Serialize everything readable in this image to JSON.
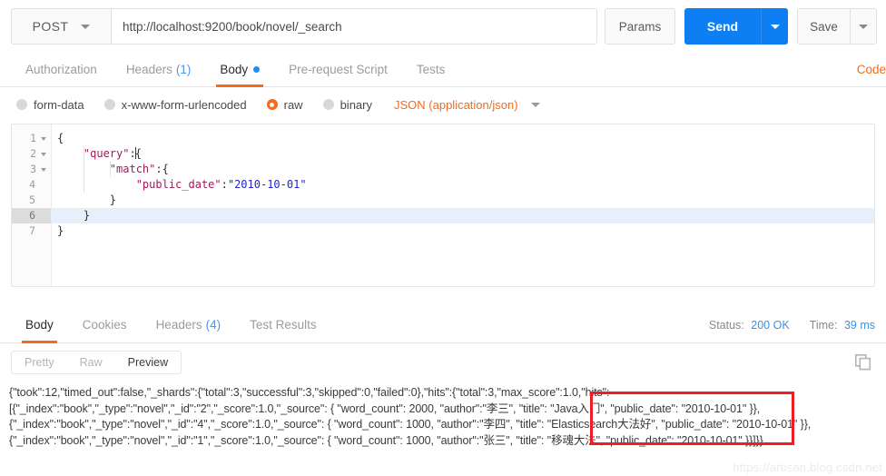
{
  "request": {
    "method": "POST",
    "url": "http://localhost:9200/book/novel/_search",
    "params_label": "Params",
    "send_label": "Send",
    "save_label": "Save",
    "tabs": [
      {
        "label": "Authorization",
        "count": "",
        "active": false
      },
      {
        "label": "Headers",
        "count": "(1)",
        "active": false
      },
      {
        "label": "Body",
        "count": "",
        "active": true
      },
      {
        "label": "Pre-request Script",
        "count": "",
        "active": false
      },
      {
        "label": "Tests",
        "count": "",
        "active": false
      }
    ],
    "code_link": "Code",
    "body_types": [
      {
        "label": "form-data",
        "selected": false
      },
      {
        "label": "x-www-form-urlencoded",
        "selected": false
      },
      {
        "label": "raw",
        "selected": true
      },
      {
        "label": "binary",
        "selected": false
      }
    ],
    "content_type": "JSON (application/json)"
  },
  "editor": {
    "lines": [
      {
        "n": "1",
        "fold": true,
        "current": false,
        "text": "{"
      },
      {
        "n": "2",
        "fold": true,
        "current": false,
        "text": "    \"query\":{"
      },
      {
        "n": "3",
        "fold": true,
        "current": false,
        "text": "        \"match\":{"
      },
      {
        "n": "4",
        "fold": false,
        "current": false,
        "text": "            \"public_date\":\"2010-10-01\""
      },
      {
        "n": "5",
        "fold": false,
        "current": false,
        "text": "        }"
      },
      {
        "n": "6",
        "fold": false,
        "current": true,
        "text": "    }"
      },
      {
        "n": "7",
        "fold": false,
        "current": false,
        "text": "}"
      }
    ]
  },
  "response": {
    "tabs": [
      {
        "label": "Body",
        "count": "",
        "active": true
      },
      {
        "label": "Cookies",
        "count": "",
        "active": false
      },
      {
        "label": "Headers",
        "count": "(4)",
        "active": false
      },
      {
        "label": "Test Results",
        "count": "",
        "active": false
      }
    ],
    "status_label": "Status:",
    "status_value": "200 OK",
    "time_label": "Time:",
    "time_value": "39 ms",
    "views": [
      {
        "label": "Pretty",
        "active": false
      },
      {
        "label": "Raw",
        "active": false
      },
      {
        "label": "Preview",
        "active": true
      }
    ],
    "body_lines": [
      "{\"took\":12,\"timed_out\":false,\"_shards\":{\"total\":3,\"successful\":3,\"skipped\":0,\"failed\":0},\"hits\":{\"total\":3,\"max_score\":1.0,\"hits\":",
      "[{\"_index\":\"book\",\"_type\":\"novel\",\"_id\":\"2\",\"_score\":1.0,\"_source\": { \"word_count\": 2000, \"author\":\"李三\", \"title\": \"Java入门\", \"public_date\": \"2010-10-01\" }},",
      "{\"_index\":\"book\",\"_type\":\"novel\",\"_id\":\"4\",\"_score\":1.0,\"_source\": { \"word_count\": 1000, \"author\":\"李四\", \"title\": \"Elasticsearch大法好\", \"public_date\": \"2010-10-01\" }},",
      "{\"_index\":\"book\",\"_type\":\"novel\",\"_id\":\"1\",\"_score\":1.0,\"_source\": { \"word_count\": 1000, \"author\":\"张三\", \"title\": \"移魂大法\", \"public_date\": \"2010-10-01\" }}]}}"
    ]
  },
  "watermark": "https://artisan.blog.csdn.net",
  "colors": {
    "accent_orange": "#f26b21",
    "send_blue": "#0d7ff2",
    "link_blue": "#3f8fe0",
    "annotation_red": "#ee1c25"
  }
}
